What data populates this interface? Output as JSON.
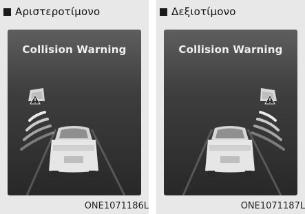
{
  "figures": [
    {
      "heading": "Αριστεροτίμονο",
      "message": "Collision Warning",
      "code": "ONE1071186L",
      "side": "left"
    },
    {
      "heading": "Δεξιοτίμονο",
      "message": "Collision Warning",
      "code": "ONE1071187L",
      "side": "right"
    }
  ],
  "icons": [
    "warning-triangle-icon",
    "bullet-square-icon"
  ]
}
